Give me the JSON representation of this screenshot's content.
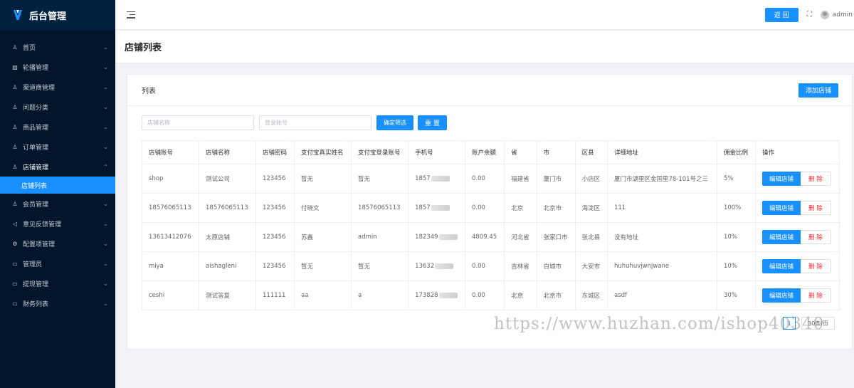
{
  "brand": {
    "title": "后台管理",
    "accent": "#1890ff",
    "sidebar_bg": "#001529"
  },
  "sidebar": {
    "items": [
      {
        "label": "首页",
        "icon": "person-icon"
      },
      {
        "label": "轮播管理",
        "icon": "image-icon"
      },
      {
        "label": "渠道商管理",
        "icon": "person-icon"
      },
      {
        "label": "问题分类",
        "icon": "person-icon"
      },
      {
        "label": "商品管理",
        "icon": "person-icon"
      },
      {
        "label": "订单管理",
        "icon": "person-icon"
      },
      {
        "label": "店铺管理",
        "icon": "person-icon",
        "open": true
      },
      {
        "label": "会员管理",
        "icon": "person-icon"
      },
      {
        "label": "意见反馈管理",
        "icon": "megaphone-icon"
      },
      {
        "label": "配置项管理",
        "icon": "gear-icon"
      },
      {
        "label": "管理员",
        "icon": "folder-icon"
      },
      {
        "label": "提现管理",
        "icon": "folder-icon"
      },
      {
        "label": "财务列表",
        "icon": "folder-icon"
      }
    ],
    "active_sub": "店铺列表"
  },
  "header": {
    "back_label": "返 回",
    "username": "admin"
  },
  "page": {
    "title": "店铺列表"
  },
  "card": {
    "title": "列表",
    "add_label": "添加店铺"
  },
  "filters": {
    "name_placeholder": "店铺名称",
    "account_placeholder": "登录账号",
    "filter_label": "确定筛选",
    "reset_label": "重 置"
  },
  "table": {
    "columns": [
      "店铺账号",
      "店铺名称",
      "店铺密码",
      "支付宝真实姓名",
      "支付宝登录账号",
      "手机号",
      "账户余额",
      "省",
      "市",
      "区县",
      "详细地址",
      "佣金比例",
      "操作"
    ],
    "edit_label": "编辑店铺",
    "delete_label": "删 除",
    "rows": [
      {
        "account": "shop",
        "name": "测试公司",
        "password": "123456",
        "alipay_name": "暂无",
        "alipay_account": "暂无",
        "phone": "1857",
        "balance": "0.00",
        "province": "福建省",
        "city": "厦门市",
        "district": "小店区",
        "address": "厦门市湖里区金国里78-101号之三",
        "commission": "5%"
      },
      {
        "account": "18576065113",
        "name": "18576065113",
        "password": "123456",
        "alipay_name": "付晓文",
        "alipay_account": "18576065113",
        "phone": "1857",
        "balance": "0.00",
        "province": "北京",
        "city": "北京市",
        "district": "海淀区",
        "address": "111",
        "commission": "100%"
      },
      {
        "account": "13613412076",
        "name": "太原店铺",
        "password": "123456",
        "alipay_name": "苏鑫",
        "alipay_account": "admin",
        "phone": "182349",
        "balance": "4809.45",
        "province": "河北省",
        "city": "张家口市",
        "district": "张北县",
        "address": "没有地址",
        "commission": "10%"
      },
      {
        "account": "miya",
        "name": "aishagleni",
        "password": "123456",
        "alipay_name": "暂无",
        "alipay_account": "暂无",
        "phone": "13632",
        "balance": "0.00",
        "province": "吉林省",
        "city": "白城市",
        "district": "大安市",
        "address": "huhuhuvjwnjwane",
        "commission": "10%"
      },
      {
        "account": "ceshi",
        "name": "测试答复",
        "password": "111111",
        "alipay_name": "aa",
        "alipay_account": "a",
        "phone": "173828",
        "balance": "0.00",
        "province": "北京",
        "city": "北京市",
        "district": "东城区",
        "address": "asdf",
        "commission": "30%"
      }
    ]
  },
  "pagination": {
    "current": "1",
    "page_size": "30条/页"
  },
  "watermark": "https://www.huzhan.com/ishop40340"
}
